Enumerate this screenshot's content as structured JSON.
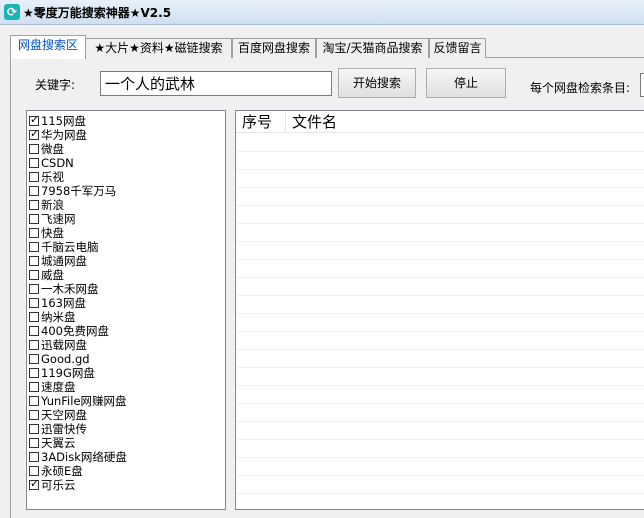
{
  "window": {
    "title": "★零度万能搜索神器★V2.5"
  },
  "tabs": [
    {
      "label": "网盘搜索区",
      "active": true
    },
    {
      "label": "★大片★资料★磁链搜索",
      "active": false
    },
    {
      "label": "百度网盘搜索",
      "active": false
    },
    {
      "label": "淘宝/天猫商品搜索",
      "active": false
    },
    {
      "label": "反馈留言",
      "active": false
    }
  ],
  "search": {
    "keyword_label": "关键字:",
    "keyword_value": "一个人的武林",
    "start_button": "开始搜索",
    "stop_button": "停止",
    "count_label": "每个网盘检索条目:"
  },
  "disks": [
    {
      "label": "115网盘",
      "checked": true
    },
    {
      "label": "华为网盘",
      "checked": true
    },
    {
      "label": "微盘",
      "checked": false
    },
    {
      "label": "CSDN",
      "checked": false
    },
    {
      "label": "乐视",
      "checked": false
    },
    {
      "label": "7958千军万马",
      "checked": false
    },
    {
      "label": "新浪",
      "checked": false
    },
    {
      "label": "飞速网",
      "checked": false
    },
    {
      "label": "快盘",
      "checked": false
    },
    {
      "label": "千脑云电脑",
      "checked": false
    },
    {
      "label": "城通网盘",
      "checked": false
    },
    {
      "label": "威盘",
      "checked": false
    },
    {
      "label": "一木禾网盘",
      "checked": false
    },
    {
      "label": "163网盘",
      "checked": false
    },
    {
      "label": "纳米盘",
      "checked": false
    },
    {
      "label": "400免费网盘",
      "checked": false
    },
    {
      "label": "迅载网盘",
      "checked": false
    },
    {
      "label": "Good.gd",
      "checked": false
    },
    {
      "label": "119G网盘",
      "checked": false
    },
    {
      "label": "速度盘",
      "checked": false
    },
    {
      "label": "YunFile网赚网盘",
      "checked": false
    },
    {
      "label": "天空网盘",
      "checked": false
    },
    {
      "label": "迅雷快传",
      "checked": false
    },
    {
      "label": "天翼云",
      "checked": false
    },
    {
      "label": "3ADisk网络硬盘",
      "checked": false
    },
    {
      "label": "永硕E盘",
      "checked": false
    },
    {
      "label": "可乐云",
      "checked": true
    }
  ],
  "results": {
    "columns": [
      "序号",
      "文件名"
    ]
  }
}
